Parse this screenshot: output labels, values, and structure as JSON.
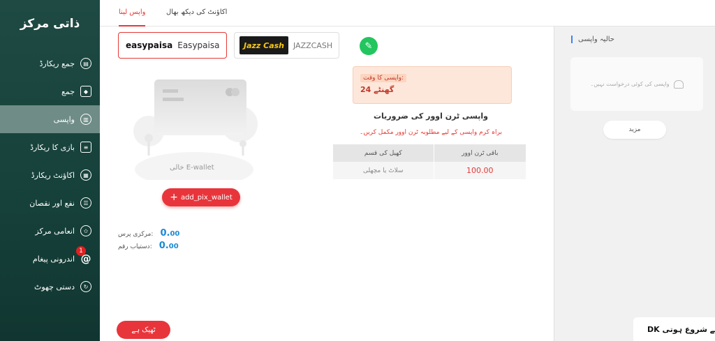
{
  "sidebar": {
    "title": "ذاتی مرکز",
    "items": [
      {
        "label": "جمع ریکارڈ",
        "icon": "record-icon"
      },
      {
        "label": "جمع",
        "icon": "deposit-icon"
      },
      {
        "label": "واپسی",
        "icon": "withdraw-icon",
        "active": true
      },
      {
        "label": "بازی کا ریکارڈ",
        "icon": "clipboard-icon"
      },
      {
        "label": "اکاؤنٹ ریکارڈ",
        "icon": "account-record-icon"
      },
      {
        "label": "نفع اور نقصان",
        "icon": "list-icon"
      },
      {
        "label": "انعامی مرکز",
        "icon": "star-icon"
      },
      {
        "label": "اندرونی پیغام",
        "icon": "at-icon",
        "badge": "1"
      },
      {
        "label": "دستی چھوٹ",
        "icon": "rebate-icon"
      }
    ]
  },
  "tabs": {
    "withdraw": "واپس لینا",
    "account_manage": "اکاؤنٹ کی دیکھ بھال"
  },
  "wallets": {
    "easypaisa_logo": "easypaisa",
    "easypaisa_name": "Easypaisa",
    "jazzcash_logo": "Jazz Cash",
    "jazzcash_name": "JAZZCASH"
  },
  "ewallet": {
    "empty_label": "خالی E-wallet",
    "add_button": "add_pix_wallet"
  },
  "balances": {
    "center_wallet_label": "مرکزی پرس:",
    "center_wallet_value": "0.",
    "center_wallet_dec": "00",
    "withdrawable_label": "دستیاب رقم:",
    "withdrawable_value": "0.",
    "withdrawable_dec": "00"
  },
  "withdraw_time": {
    "label": "واپسی کا وقت:",
    "value": "24 گھنٹے"
  },
  "requirements": {
    "title": "واپسی ٹرن اوور کی ضروریات",
    "note": "براہ کرم واپسی کے لیے مطلوبہ ٹرن اوور مکمل کریں۔",
    "headers": [
      "باقی ٹرن اوور",
      "کھیل کی قسم"
    ],
    "rows": [
      [
        "100.00",
        "سلاٹ یا مچھلی"
      ]
    ]
  },
  "save_button": "ٹھیک ہے",
  "right_panel": {
    "title": "حالیہ واپسی",
    "empty_text": "واپسی کی کوئی درخواست نہیں۔",
    "more_button": "مزید"
  },
  "toast": "DK سے شروع ہوتی",
  "colors": {
    "accent": "#e8353b",
    "sidebar": "#1f4a44",
    "balance": "#1a8ad3"
  }
}
